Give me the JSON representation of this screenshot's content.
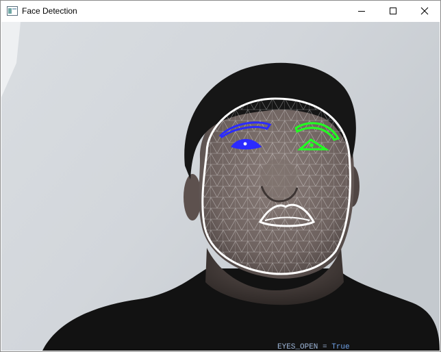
{
  "window": {
    "title": "Face Detection",
    "controls": {
      "minimize": "minimize-icon",
      "maximize": "maximize-icon",
      "close": "close-icon"
    }
  },
  "overlay": {
    "mesh_color": "#ffffff",
    "left_eye_color": "#2b2bff",
    "right_eye_color": "#22ff22",
    "contour_color": "#ffffff"
  },
  "background_text": {
    "code_fragment": "EYES_OPEN = ",
    "code_value": "True"
  }
}
